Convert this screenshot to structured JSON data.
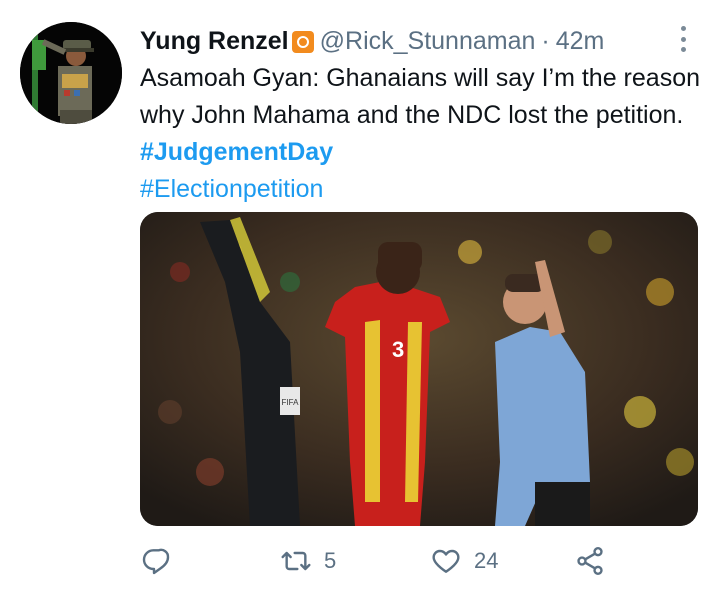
{
  "tweet": {
    "author_name": "Yung Renzel",
    "handle": "@Rick_Stunnaman",
    "separator": "·",
    "time": "42m",
    "text": "Asamoah Gyan: Ghanaians will say  I’m the reason why John Mahama and the NDC lost the petition. ",
    "hashtags": [
      "#JudgementDay",
      "#Electionpetition"
    ]
  },
  "media": {
    "player_number": "3",
    "referee_badge": "FIFA"
  },
  "actions": {
    "retweet_count": "5",
    "like_count": "24"
  },
  "icons": {
    "avatar": "saluting-general-avatar",
    "badge": "orange-square-badge-icon",
    "more": "more-vertical-icon",
    "reply": "reply-icon",
    "retweet": "retweet-icon",
    "like": "heart-icon",
    "share": "share-icon"
  },
  "colors": {
    "link": "#1d9bf0",
    "muted": "#5b7083",
    "text": "#0f1419",
    "badge": "#f28b1e"
  }
}
